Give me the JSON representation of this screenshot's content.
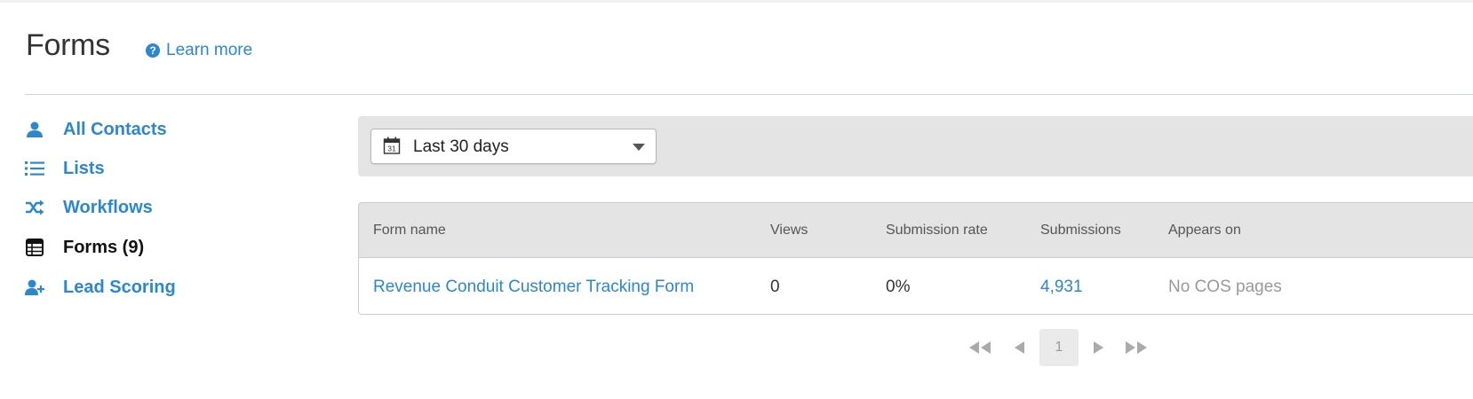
{
  "header": {
    "title": "Forms",
    "learn_more": "Learn more",
    "help_glyph": "?"
  },
  "sidebar": {
    "items": [
      {
        "label": "All Contacts",
        "icon": "person-icon",
        "active": false
      },
      {
        "label": "Lists",
        "icon": "list-icon",
        "active": false
      },
      {
        "label": "Workflows",
        "icon": "shuffle-icon",
        "active": false
      },
      {
        "label": "Forms (9)",
        "icon": "form-table-icon",
        "active": true
      },
      {
        "label": "Lead Scoring",
        "icon": "add-person-icon",
        "active": false
      }
    ]
  },
  "filter": {
    "date_range": "Last 30 days",
    "calendar_day": "31"
  },
  "table": {
    "columns": [
      "Form name",
      "Views",
      "Submission rate",
      "Submissions",
      "Appears on"
    ],
    "rows": [
      {
        "form_name": "Revenue Conduit Customer Tracking Form",
        "views": "0",
        "submission_rate": "0%",
        "submissions": "4,931",
        "appears_on": "No COS pages"
      }
    ]
  },
  "pagination": {
    "current_page": "1"
  },
  "colors": {
    "link": "#2a87d0",
    "active_text": "#111111",
    "muted": "#999999",
    "panel_bg": "#e4e4e4"
  }
}
